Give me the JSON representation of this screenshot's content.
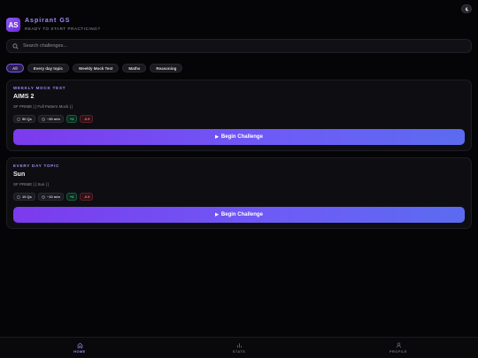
{
  "header": {
    "logo_text": "AS",
    "title": "Aspirant GS",
    "subtitle": "READY TO START PRACTICING?",
    "corner_icon": "moon-icon"
  },
  "search": {
    "placeholder": "Search challenges..."
  },
  "filters": [
    {
      "label": "All",
      "active": true
    },
    {
      "label": "Every day topic",
      "active": false
    },
    {
      "label": "Weekly Mock Test",
      "active": false
    },
    {
      "label": "Maths",
      "active": false
    },
    {
      "label": "Reasoning",
      "active": false
    }
  ],
  "cards": [
    {
      "category": "WEEKLY MOCK TEST",
      "title": "AIMS 2",
      "subtitle": "SF PRIME | | Full Pattern Mock | |",
      "questions": "50 Qs",
      "time": "~30 min",
      "positive": "+2",
      "negative": "-0.5",
      "cta": "Begin Challenge"
    },
    {
      "category": "EVERY DAY TOPIC",
      "title": "Sun",
      "subtitle": "SF PRIME | | Sun | |",
      "questions": "10 Qs",
      "time": "~10 min",
      "positive": "+2",
      "negative": "-0.5",
      "cta": "Begin Challenge"
    }
  ],
  "nav": [
    {
      "label": "HOME",
      "icon": "home-icon",
      "active": true
    },
    {
      "label": "STATS",
      "icon": "bar-chart-icon",
      "active": false
    },
    {
      "label": "PROFILE",
      "icon": "user-icon",
      "active": false
    }
  ],
  "colors": {
    "accent": "#a78bfa",
    "button_start": "#7c3aed",
    "button_end": "#5b6bf0",
    "positive": "#4ade80",
    "negative": "#f87171"
  }
}
